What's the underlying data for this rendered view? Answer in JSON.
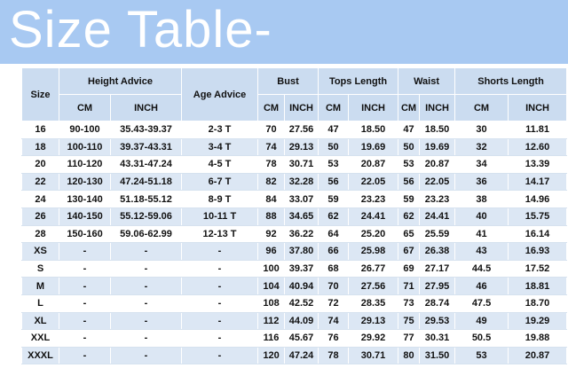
{
  "banner": {
    "title": "Size Table-"
  },
  "table": {
    "headers": {
      "size": "Size",
      "height_advice": "Height Advice",
      "age_advice": "Age Advice",
      "bust": "Bust",
      "tops_length": "Tops Length",
      "waist": "Waist",
      "shorts_length": "Shorts Length"
    },
    "subheaders": [
      "CM",
      "INCH",
      "CM",
      "INCH",
      "CM",
      "INCH",
      "CM",
      "INCH",
      "CM",
      "INCH"
    ],
    "rows": [
      [
        "16",
        "90-100",
        "35.43-39.37",
        "2-3 T",
        "70",
        "27.56",
        "47",
        "18.50",
        "47",
        "18.50",
        "30",
        "11.81"
      ],
      [
        "18",
        "100-110",
        "39.37-43.31",
        "3-4 T",
        "74",
        "29.13",
        "50",
        "19.69",
        "50",
        "19.69",
        "32",
        "12.60"
      ],
      [
        "20",
        "110-120",
        "43.31-47.24",
        "4-5 T",
        "78",
        "30.71",
        "53",
        "20.87",
        "53",
        "20.87",
        "34",
        "13.39"
      ],
      [
        "22",
        "120-130",
        "47.24-51.18",
        "6-7 T",
        "82",
        "32.28",
        "56",
        "22.05",
        "56",
        "22.05",
        "36",
        "14.17"
      ],
      [
        "24",
        "130-140",
        "51.18-55.12",
        "8-9 T",
        "84",
        "33.07",
        "59",
        "23.23",
        "59",
        "23.23",
        "38",
        "14.96"
      ],
      [
        "26",
        "140-150",
        "55.12-59.06",
        "10-11 T",
        "88",
        "34.65",
        "62",
        "24.41",
        "62",
        "24.41",
        "40",
        "15.75"
      ],
      [
        "28",
        "150-160",
        "59.06-62.99",
        "12-13 T",
        "92",
        "36.22",
        "64",
        "25.20",
        "65",
        "25.59",
        "41",
        "16.14"
      ],
      [
        "XS",
        "-",
        "-",
        "-",
        "96",
        "37.80",
        "66",
        "25.98",
        "67",
        "26.38",
        "43",
        "16.93"
      ],
      [
        "S",
        "-",
        "-",
        "-",
        "100",
        "39.37",
        "68",
        "26.77",
        "69",
        "27.17",
        "44.5",
        "17.52"
      ],
      [
        "M",
        "-",
        "-",
        "-",
        "104",
        "40.94",
        "70",
        "27.56",
        "71",
        "27.95",
        "46",
        "18.81"
      ],
      [
        "L",
        "-",
        "-",
        "-",
        "108",
        "42.52",
        "72",
        "28.35",
        "73",
        "28.74",
        "47.5",
        "18.70"
      ],
      [
        "XL",
        "-",
        "-",
        "-",
        "112",
        "44.09",
        "74",
        "29.13",
        "75",
        "29.53",
        "49",
        "19.29"
      ],
      [
        "XXL",
        "-",
        "-",
        "-",
        "116",
        "45.67",
        "76",
        "29.92",
        "77",
        "30.31",
        "50.5",
        "19.88"
      ],
      [
        "XXXL",
        "-",
        "-",
        "-",
        "120",
        "47.24",
        "78",
        "30.71",
        "80",
        "31.50",
        "53",
        "20.87"
      ]
    ]
  },
  "colors": {
    "banner": "#a8c9f2",
    "header": "#cbdcf0",
    "row_alt": "#dce7f4"
  }
}
